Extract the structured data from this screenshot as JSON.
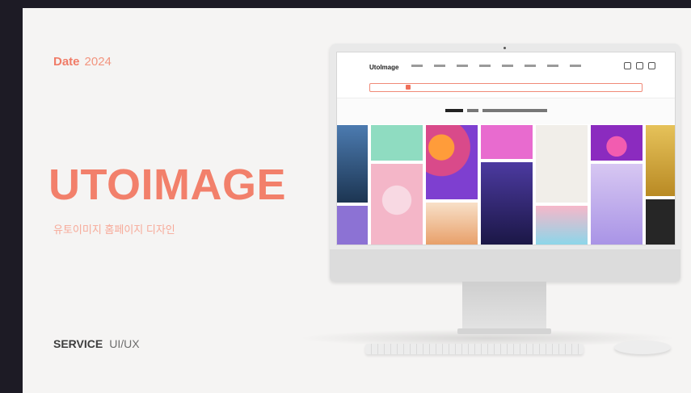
{
  "project": {
    "date_label": "Date",
    "date_year": "2024",
    "title": "UTOIMAGE",
    "subtitle": "유토이미지 홈페이지 디자인",
    "service_label": "SERVICE",
    "service_value": "UI/UX"
  },
  "screen": {
    "site_logo": "UtoImage",
    "nav_items": 8,
    "colors": {
      "accent": "#f2806b",
      "tiles": [
        "#2d4f7a",
        "#7ad0b6",
        "#d94a8a",
        "#e86bcf",
        "#f0eeea",
        "#8b2bbf",
        "#d8a93a",
        "#7a5fd1",
        "#f5c6d6",
        "#3a2a7a",
        "#f3f0ec",
        "#f7b15a",
        "#c4a9e8",
        "#2a2a2a"
      ]
    }
  }
}
